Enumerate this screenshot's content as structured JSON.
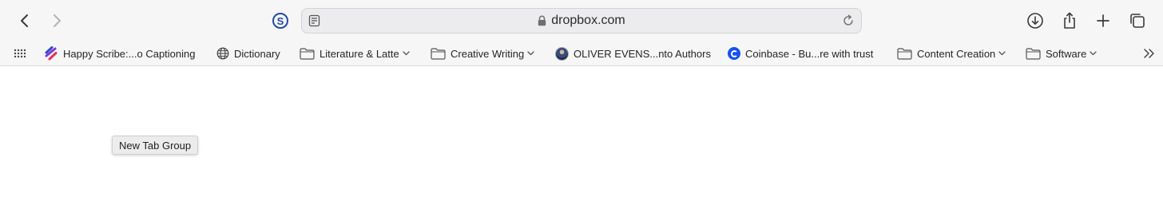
{
  "toolbar": {
    "back_icon": "chevron-left-icon",
    "forward_icon": "chevron-right-icon",
    "extension_letter": "S",
    "address": {
      "domain": "dropbox.com",
      "lock_icon": "lock-icon",
      "reader_icon": "reader-icon",
      "reload_icon": "reload-icon"
    },
    "right_icons": [
      "download-icon",
      "share-icon",
      "plus-icon",
      "tabs-overview-icon"
    ]
  },
  "bookmarks": {
    "items": [
      {
        "label": "Happy Scribe:...o Captioning",
        "icon": "happy-scribe-icon"
      },
      {
        "label": "Dictionary",
        "icon": "globe-icon"
      },
      {
        "label": "Literature & Latte",
        "icon": "folder-icon",
        "has_menu": true
      },
      {
        "label": "Creative Writing",
        "icon": "folder-icon",
        "has_menu": true
      },
      {
        "label": "OLIVER EVENS...nto Authors",
        "icon": "avatar"
      },
      {
        "label": "Coinbase - Bu...re with trust",
        "icon": "coinbase-icon"
      },
      {
        "label": "Content Creation",
        "icon": "folder-icon",
        "has_menu": true
      },
      {
        "label": "Software",
        "icon": "folder-icon",
        "has_menu": true
      }
    ],
    "overflow_icon": "double-chevron-right-icon",
    "apps_icon": "grid-icon"
  },
  "tooltip": {
    "text": "New Tab Group"
  },
  "colors": {
    "toolbar_bg": "#f6f6f6",
    "address_bg": "#ececee",
    "extension_blue": "#2449a8",
    "coinbase_blue": "#1652f0"
  }
}
